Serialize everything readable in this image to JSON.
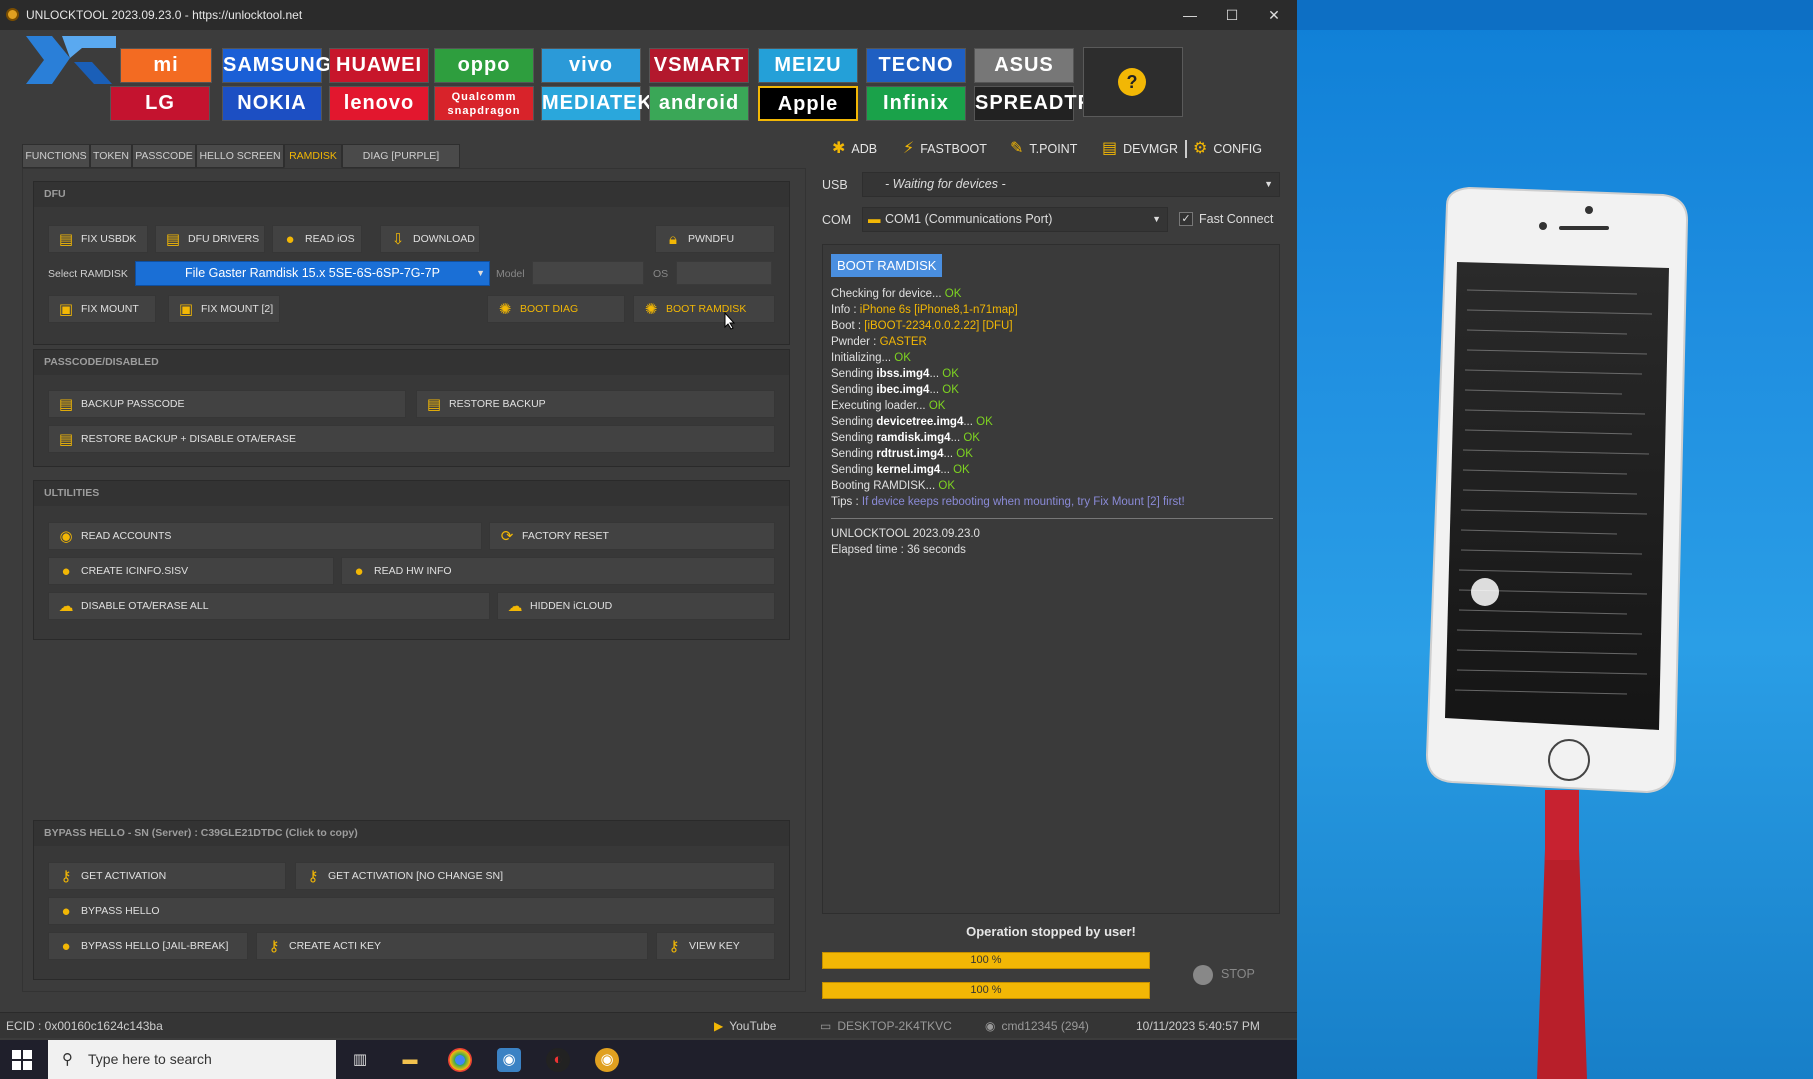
{
  "window": {
    "title": "UNLOCKTOOL 2023.09.23.0 - https://unlocktool.net",
    "minimize": "—",
    "maximize": "☐",
    "close": "✕"
  },
  "brands": [
    {
      "label": "mi",
      "color": "#f36b22",
      "fg": "#ffffff"
    },
    {
      "label": "SAMSUNG",
      "color": "#1a5fd6",
      "fg": "#ffffff"
    },
    {
      "label": "HUAWEI",
      "color": "#c7162b",
      "fg": "#ffffff"
    },
    {
      "label": "oppo",
      "color": "#2e9e3e",
      "fg": "#ffffff"
    },
    {
      "label": "vivo",
      "color": "#2b9ad8",
      "fg": "#ffffff"
    },
    {
      "label": "VSMART",
      "color": "#b3182d",
      "fg": "#ffffff"
    },
    {
      "label": "MEIZU",
      "color": "#24a0d8",
      "fg": "#ffffff"
    },
    {
      "label": "TECNO",
      "color": "#1f5fc2",
      "fg": "#ffffff"
    },
    {
      "label": "ASUS",
      "color": "#777777",
      "fg": "#ffffff"
    },
    {
      "label": "LG",
      "color": "#c4132f",
      "fg": "#ffffff"
    },
    {
      "label": "NOKIA",
      "color": "#1c4fc3",
      "fg": "#ffffff"
    },
    {
      "label": "lenovo",
      "color": "#e2172e",
      "fg": "#ffffff"
    },
    {
      "label": "Qualcomm snapdragon",
      "color": "#d8232a",
      "fg": "#ffffff"
    },
    {
      "label": "MEDIATEK",
      "color": "#2aa7dc",
      "fg": "#ffffff"
    },
    {
      "label": "android",
      "color": "#3aa757",
      "fg": "#ffffff"
    },
    {
      "label": "Apple",
      "color": "#000000",
      "fg": "#ffffff"
    },
    {
      "label": "Infinix",
      "color": "#1aa24a",
      "fg": "#ffffff"
    },
    {
      "label": "SPREADTRUM",
      "color": "#222222",
      "fg": "#ffffff"
    }
  ],
  "help_icon": "question-icon",
  "tabs": [
    "FUNCTIONS",
    "TOKEN",
    "PASSCODE",
    "HELLO SCREEN",
    "RAMDISK",
    "DIAG [PURPLE]"
  ],
  "active_tab": "RAMDISK",
  "dfu": {
    "title": "DFU",
    "fix_usbdk": "FIX USBDK",
    "dfu_drivers": "DFU DRIVERS",
    "read_ios": "READ iOS",
    "download": "DOWNLOAD",
    "pwndfu": "PWNDFU",
    "select_label": "Select RAMDISK",
    "select_value": "File Gaster Ramdisk 15.x 5SE-6S-6SP-7G-7P",
    "model_label": "Model",
    "os_label": "OS",
    "fix_mount": "FIX MOUNT",
    "fix_mount2": "FIX MOUNT [2]",
    "boot_diag": "BOOT DIAG",
    "boot_ramdisk": "BOOT RAMDISK"
  },
  "passcode": {
    "title": "PASSCODE/DISABLED",
    "backup": "BACKUP PASSCODE",
    "restore": "RESTORE BACKUP",
    "restore_disable": "RESTORE BACKUP + DISABLE OTA/ERASE"
  },
  "utilities": {
    "title": "ULTILITIES",
    "read_accounts": "READ ACCOUNTS",
    "factory_reset": "FACTORY RESET",
    "create_icinfo": "CREATE ICINFO.SISV",
    "read_hw": "READ HW INFO",
    "disable_ota": "DISABLE OTA/ERASE ALL",
    "hidden_icloud": "HIDDEN iCLOUD"
  },
  "bypass": {
    "title": "BYPASS HELLO - SN (Server) : C39GLE21DTDC (Click to copy)",
    "get_activation": "GET ACTIVATION",
    "get_activation_nc": "GET ACTIVATION [NO CHANGE SN]",
    "bypass_hello": "BYPASS HELLO",
    "bypass_jb": "BYPASS HELLO [JAIL-BREAK]",
    "create_acti": "CREATE ACTI KEY",
    "view_key": "VIEW KEY"
  },
  "toolbar": {
    "adb": "ADB",
    "fastboot": "FASTBOOT",
    "tpoint": "T.POINT",
    "devmgr": "DEVMGR",
    "config": "CONFIG"
  },
  "usb": {
    "label": "USB",
    "value": "- Waiting for devices -"
  },
  "com": {
    "label": "COM",
    "value": "COM1 (Communications Port)",
    "fast_connect": "Fast Connect"
  },
  "log": {
    "badge": "BOOT RAMDISK",
    "lines": [
      {
        "t": "Checking for device... ",
        "v": "OK",
        "c": "ok"
      },
      {
        "t": "Info : ",
        "v": "iPhone 6s [iPhone8,1-n71map]",
        "c": "y"
      },
      {
        "t": "Boot : ",
        "v": "[iBOOT-2234.0.0.2.22] [DFU]",
        "c": "y"
      },
      {
        "t": "Pwnder : ",
        "v": "GASTER",
        "c": "y"
      },
      {
        "t": "Initializing... ",
        "v": "OK",
        "c": "ok"
      },
      {
        "t": "Sending ",
        "b": "ibss.img4",
        "t2": "... ",
        "v": "OK",
        "c": "ok"
      },
      {
        "t": "Sending ",
        "b": "ibec.img4",
        "t2": "... ",
        "v": "OK",
        "c": "ok"
      },
      {
        "t": "Executing loader... ",
        "v": "OK",
        "c": "ok"
      },
      {
        "t": "Sending ",
        "b": "devicetree.img4",
        "t2": "... ",
        "v": "OK",
        "c": "ok"
      },
      {
        "t": "Sending ",
        "b": "ramdisk.img4",
        "t2": "... ",
        "v": "OK",
        "c": "ok"
      },
      {
        "t": "Sending ",
        "b": "rdtrust.img4",
        "t2": "... ",
        "v": "OK",
        "c": "ok"
      },
      {
        "t": "Sending ",
        "b": "kernel.img4",
        "t2": "... ",
        "v": "OK",
        "c": "ok"
      },
      {
        "t": "Booting RAMDISK... ",
        "v": "OK",
        "c": "ok"
      },
      {
        "t": "Tips : ",
        "v": "If device keeps rebooting when mounting, try Fix Mount [2] first!",
        "c": "tip"
      }
    ],
    "footer1": "UNLOCKTOOL 2023.09.23.0",
    "footer2": "Elapsed time : 36 seconds"
  },
  "operation": "Operation stopped by user!",
  "progress1": "100 %",
  "progress2": "100 %",
  "progress1_value": 1.0,
  "progress2_value": 1.0,
  "stop": "STOP",
  "status": {
    "ecid": "ECID : 0x00160c1624c143ba",
    "youtube": "YouTube",
    "desktop": "DESKTOP-2K4TKVC",
    "user": "cmd12345 (294)",
    "datetime": "10/11/2023 5:40:57 PM"
  },
  "taskbar": {
    "search_placeholder": "Type here to search"
  }
}
